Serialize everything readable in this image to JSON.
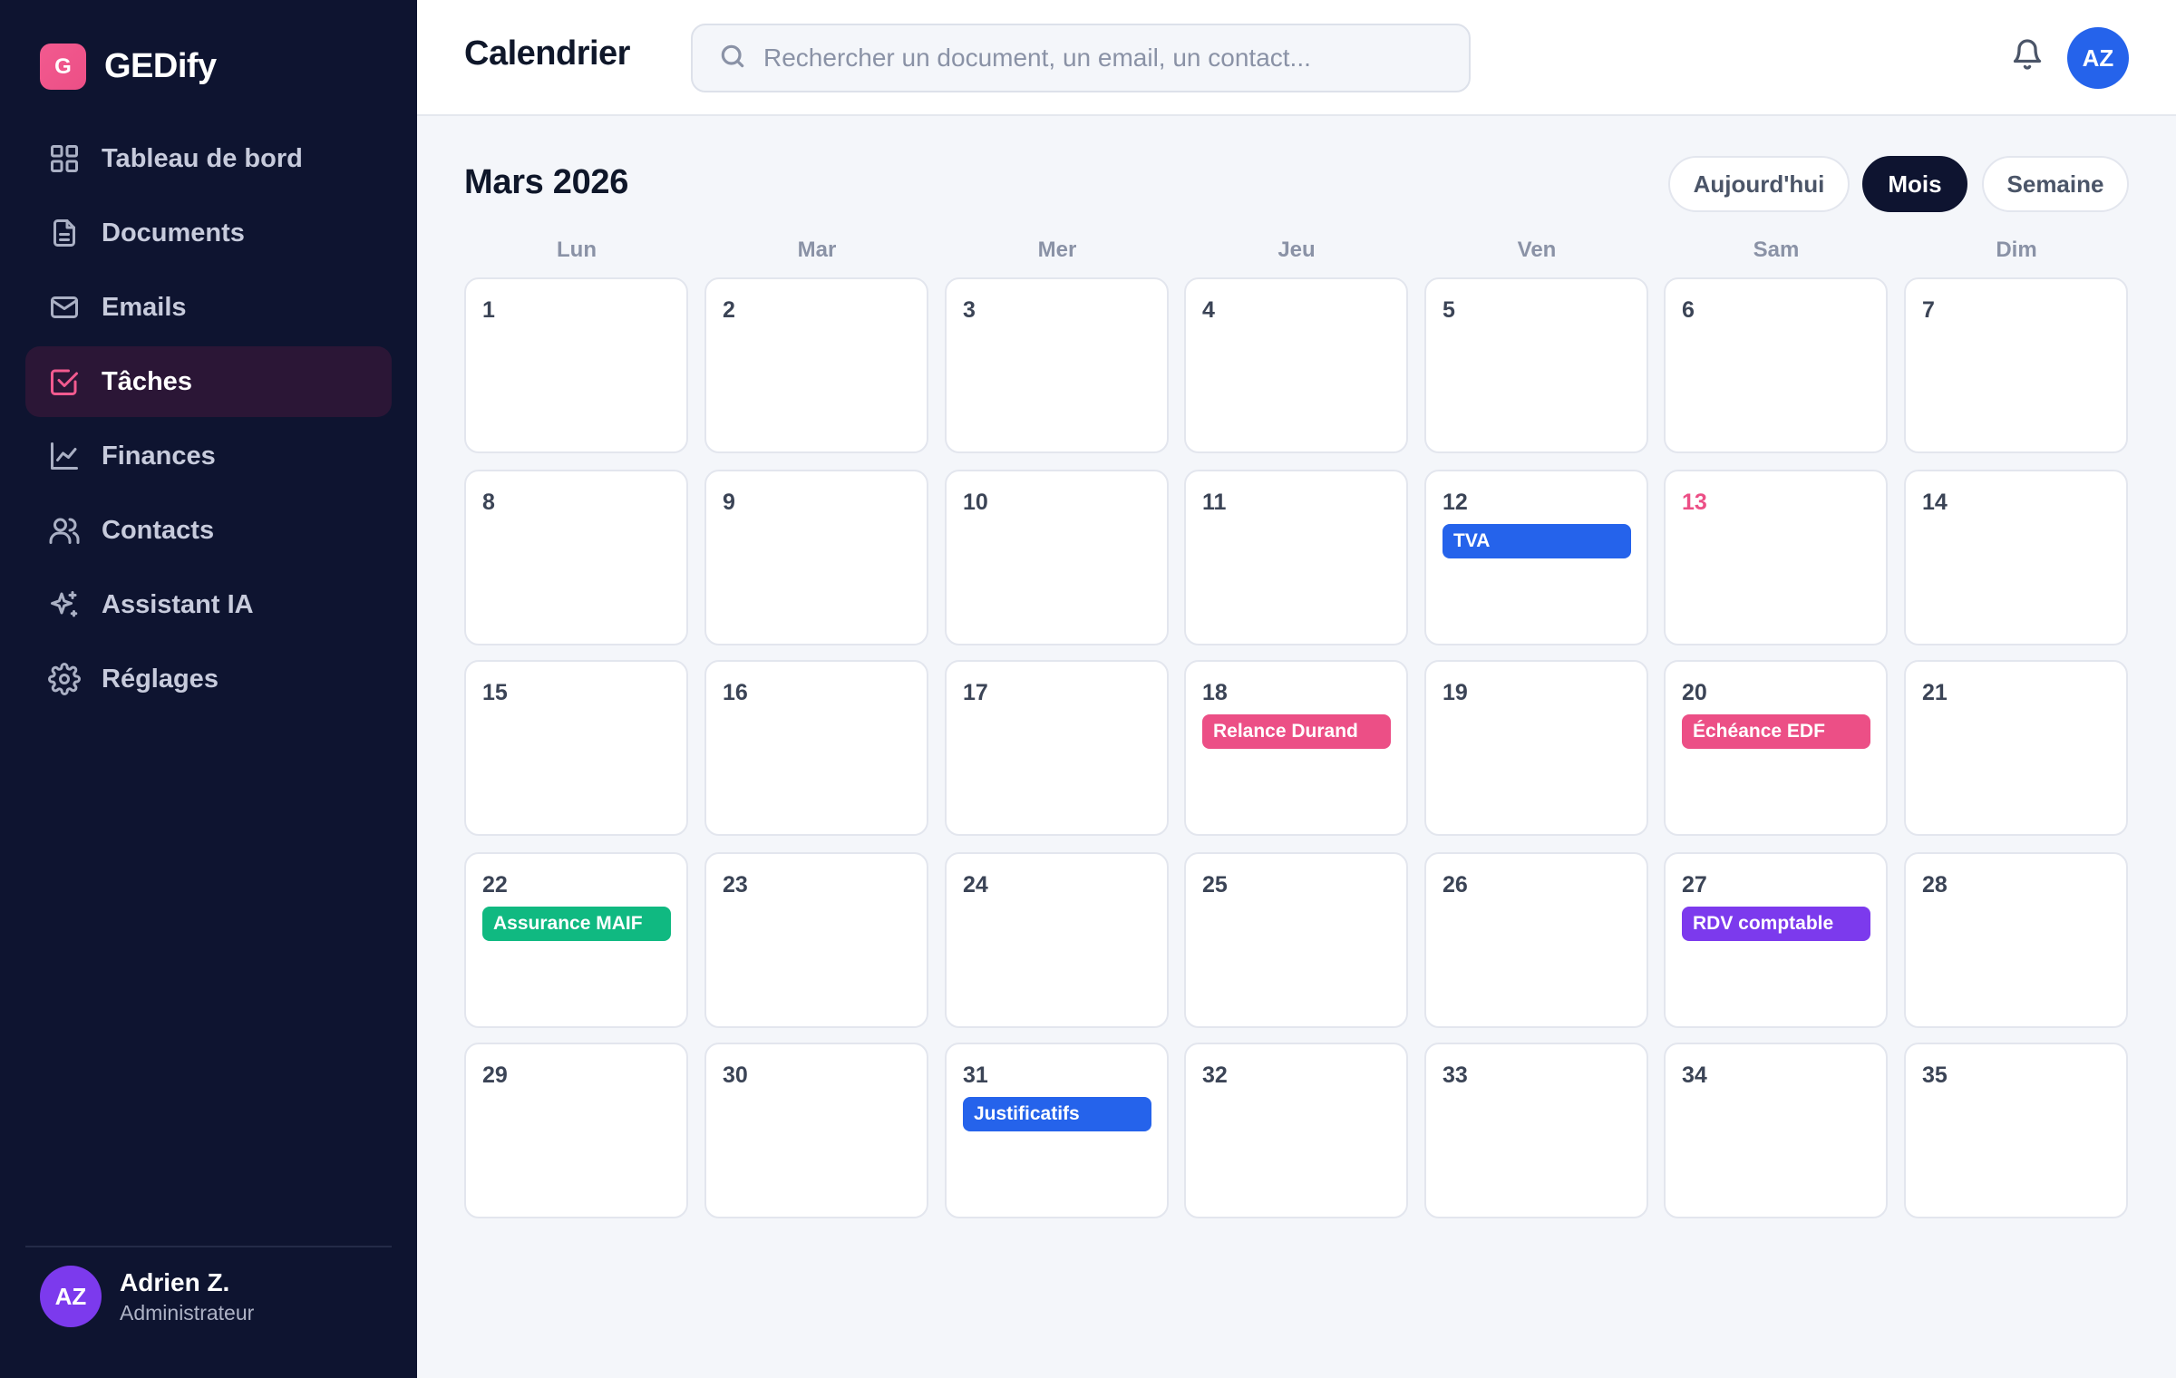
{
  "app": {
    "logo_letter": "G",
    "name": "GEDify"
  },
  "sidebar": {
    "items": [
      {
        "label": "Tableau de bord",
        "icon": "dashboard-icon"
      },
      {
        "label": "Documents",
        "icon": "document-icon"
      },
      {
        "label": "Emails",
        "icon": "mail-icon"
      },
      {
        "label": "Tâches",
        "icon": "task-check-icon",
        "active": true
      },
      {
        "label": "Finances",
        "icon": "chart-line-icon"
      },
      {
        "label": "Contacts",
        "icon": "users-icon"
      },
      {
        "label": "Assistant IA",
        "icon": "sparkle-icon"
      },
      {
        "label": "Réglages",
        "icon": "gear-icon"
      }
    ],
    "user": {
      "initials": "AZ",
      "name": "Adrien Z.",
      "role": "Administrateur"
    }
  },
  "header": {
    "title": "Calendrier",
    "search_placeholder": "Rechercher un document, un email, un contact...",
    "avatar_initials": "AZ"
  },
  "calendar": {
    "month_label": "Mars 2026",
    "view_buttons": {
      "today": "Aujourd'hui",
      "month": "Mois",
      "week": "Semaine",
      "selected": "month"
    },
    "weekdays": [
      "Lun",
      "Mar",
      "Mer",
      "Jeu",
      "Ven",
      "Sam",
      "Dim"
    ],
    "highlighted_day": "13",
    "weeks": [
      [
        "1",
        "2",
        "3",
        "4",
        "5",
        "6",
        "7"
      ],
      [
        "8",
        "9",
        "10",
        "11",
        "12",
        "13",
        "14"
      ],
      [
        "15",
        "16",
        "17",
        "18",
        "19",
        "20",
        "21"
      ],
      [
        "22",
        "23",
        "24",
        "25",
        "26",
        "27",
        "28"
      ],
      [
        "29",
        "30",
        "31",
        "32",
        "33",
        "34",
        "35"
      ]
    ],
    "events": [
      {
        "day": "12",
        "label": "TVA",
        "color": "#2563eb"
      },
      {
        "day": "18",
        "label": "Relance Durand",
        "color": "#ec4f86"
      },
      {
        "day": "20",
        "label": "Échéance EDF",
        "color": "#ec4f86"
      },
      {
        "day": "22",
        "label": "Assurance MAIF",
        "color": "#10b981"
      },
      {
        "day": "27",
        "label": "RDV comptable",
        "color": "#7c3aed"
      },
      {
        "day": "31",
        "label": "Justificatifs",
        "color": "#2563eb"
      }
    ]
  },
  "colors": {
    "sidebar_bg": "#0e1430",
    "accent_pink": "#ec4f86",
    "primary_blue": "#2563eb"
  }
}
